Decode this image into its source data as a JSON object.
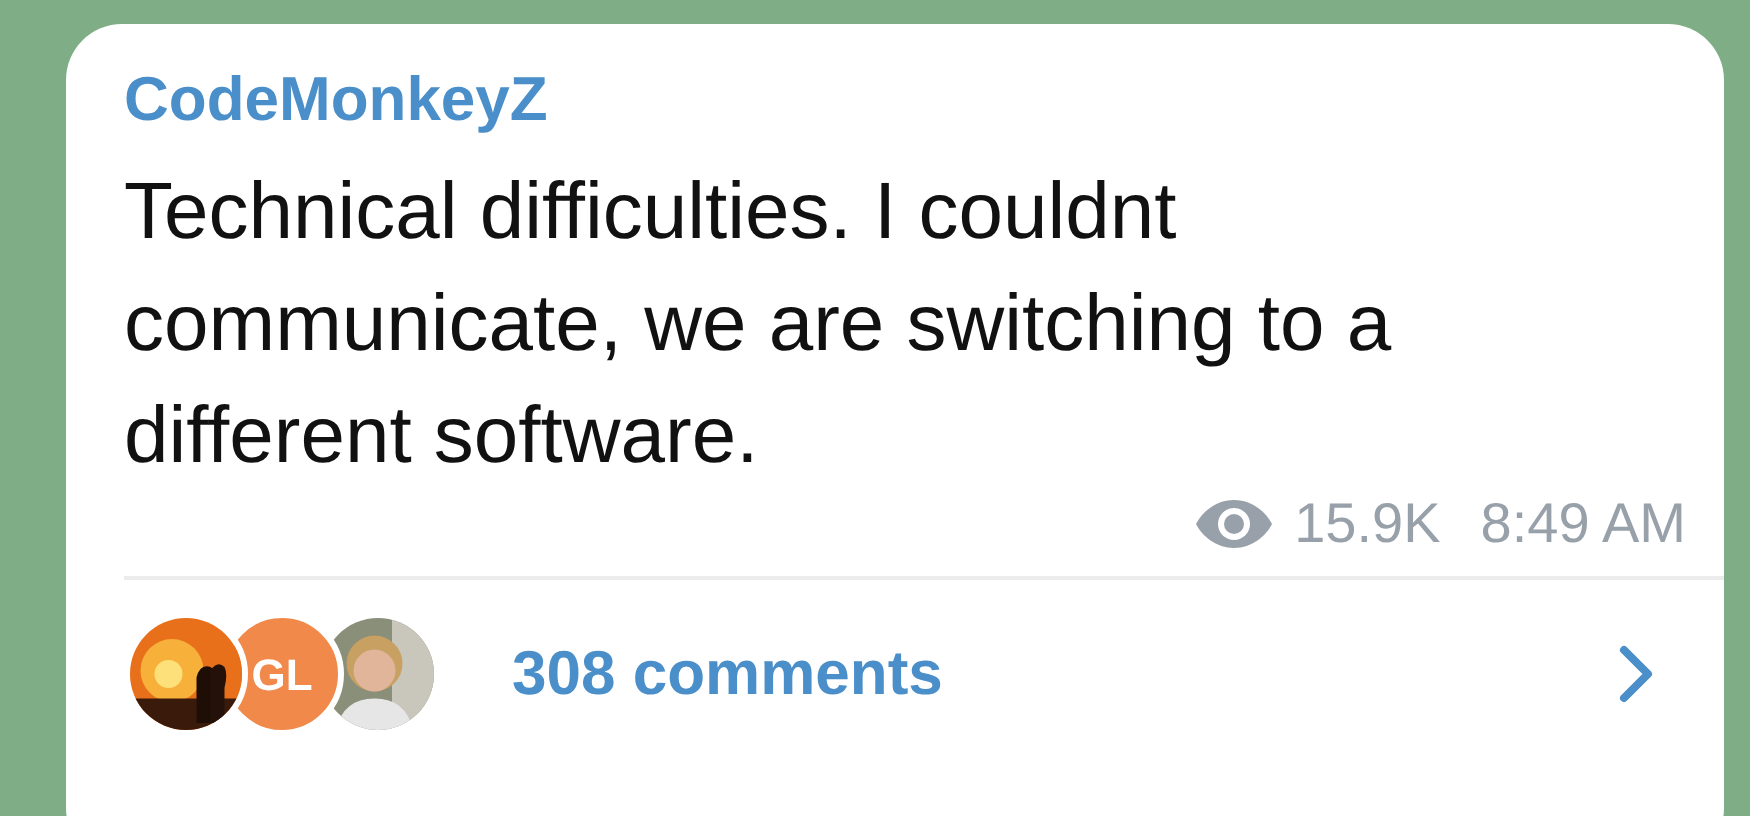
{
  "message": {
    "author": "CodeMonkeyZ",
    "text": "Technical difficulties. I couldnt communicate, we are switching to a different software.",
    "views": "15.9K",
    "time": "8:49 AM"
  },
  "comments": {
    "avatars": [
      {
        "kind": "picture"
      },
      {
        "kind": "initials",
        "initials": "GL",
        "color": "#f0894a"
      },
      {
        "kind": "picture"
      }
    ],
    "label": "308 comments"
  }
}
